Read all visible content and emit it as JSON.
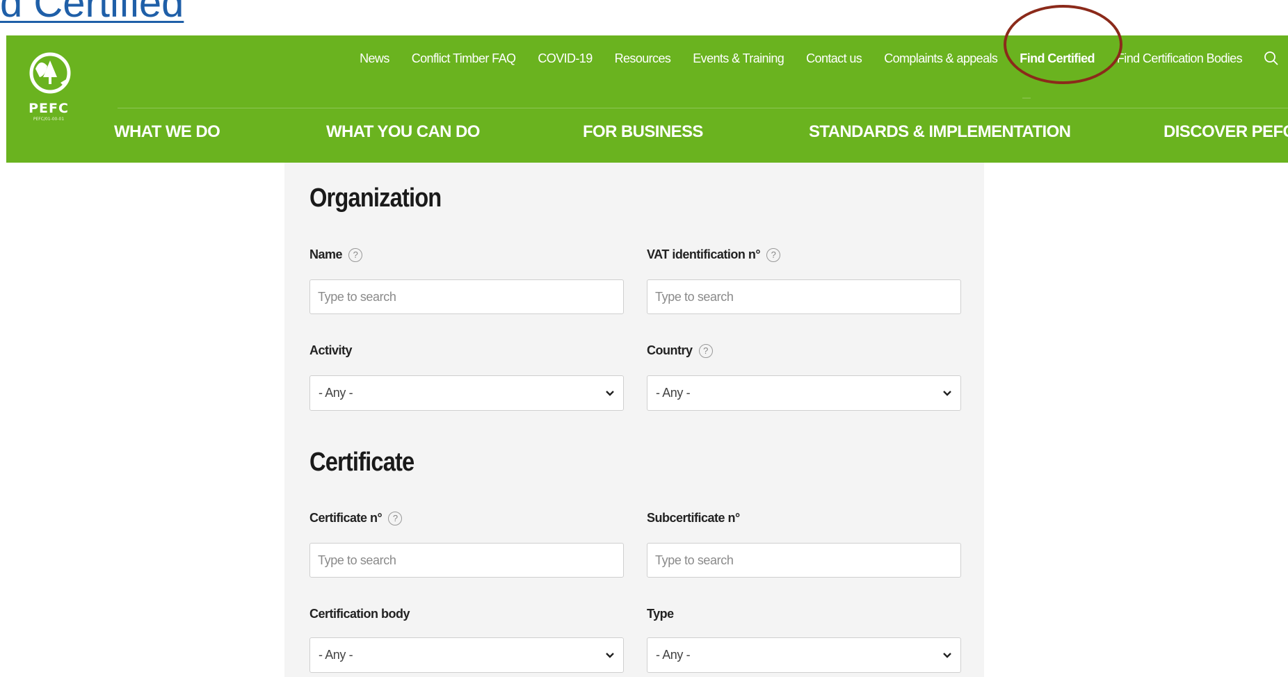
{
  "slide": {
    "title": "d Certified"
  },
  "brand": {
    "logo_text": "PEFC",
    "logo_sub": "PEFC/01-00-01"
  },
  "top_nav": [
    {
      "label": "News"
    },
    {
      "label": "Conflict Timber FAQ"
    },
    {
      "label": "COVID-19"
    },
    {
      "label": "Resources"
    },
    {
      "label": "Events & Training"
    },
    {
      "label": "Contact us"
    },
    {
      "label": "Complaints & appeals"
    },
    {
      "label": "Find Certified",
      "active": true
    },
    {
      "label": "Find Certification Bodies"
    }
  ],
  "main_nav": [
    {
      "label": "WHAT WE DO"
    },
    {
      "label": "WHAT YOU CAN DO"
    },
    {
      "label": "FOR BUSINESS"
    },
    {
      "label": "STANDARDS & IMPLEMENTATION"
    },
    {
      "label": "DISCOVER PEFC"
    }
  ],
  "form": {
    "organization": {
      "title": "Organization",
      "name_label": "Name",
      "name_placeholder": "Type to search",
      "vat_label": "VAT identification n°",
      "vat_placeholder": "Type to search",
      "activity_label": "Activity",
      "activity_value": "- Any -",
      "country_label": "Country",
      "country_value": "- Any -"
    },
    "certificate": {
      "title": "Certificate",
      "cert_no_label": "Certificate n°",
      "cert_no_placeholder": "Type to search",
      "subcert_label": "Subcertificate n°",
      "subcert_placeholder": "Type to search",
      "body_label": "Certification body",
      "body_value": "- Any -",
      "type_label": "Type",
      "type_value": "- Any -"
    },
    "help_glyph": "?"
  },
  "colors": {
    "header_green": "#6ab31f",
    "title_blue": "#1f5fa8",
    "highlight_ring": "#8b2a1a",
    "panel_bg": "#f4f4f4"
  }
}
